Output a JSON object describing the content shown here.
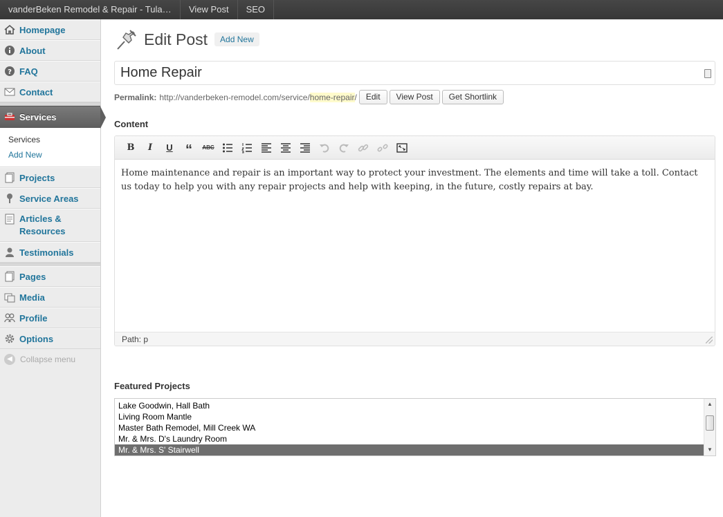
{
  "adminbar": {
    "site": "vanderBeken Remodel & Repair - Tulal...",
    "view_post": "View Post",
    "seo": "SEO"
  },
  "sidebar": {
    "items_top": [
      {
        "label": "Homepage",
        "icon": "house-icon"
      },
      {
        "label": "About",
        "icon": "info-icon"
      },
      {
        "label": "FAQ",
        "icon": "question-icon"
      },
      {
        "label": "Contact",
        "icon": "envelope-icon"
      }
    ],
    "current": {
      "label": "Services",
      "icon": "toolbox-icon"
    },
    "submenu": [
      "Services",
      "Add New"
    ],
    "items_mid": [
      {
        "label": "Projects",
        "icon": "pages-icon"
      },
      {
        "label": "Service Areas",
        "icon": "map-pin-icon"
      },
      {
        "label": "Articles & Resources",
        "icon": "document-icon"
      },
      {
        "label": "Testimonials",
        "icon": "user-icon"
      }
    ],
    "items_bottom": [
      {
        "label": "Pages",
        "icon": "pages-icon"
      },
      {
        "label": "Media",
        "icon": "media-icon"
      },
      {
        "label": "Profile",
        "icon": "users-icon"
      },
      {
        "label": "Options",
        "icon": "gear-icon"
      }
    ],
    "collapse": "Collapse menu"
  },
  "main": {
    "title": "Edit Post",
    "add_new": "Add New",
    "post_title": "Home Repair",
    "permalink_label": "Permalink:",
    "permalink_base": "http://vanderbeken-remodel.com/service/",
    "permalink_slug": "home-repair",
    "permalink_end": "/",
    "permalink_buttons": {
      "edit": "Edit",
      "view": "View Post",
      "shortlink": "Get Shortlink"
    },
    "content_label": "Content",
    "content_text": "Home maintenance and repair is an important way to protect your investment. The elements and time will take a toll. Contact us today to help you with any repair projects and help with keeping, in the future, costly repairs at bay.",
    "path": "Path: p",
    "featured_label": "Featured Projects",
    "featured_options": [
      "Lake Goodwin, Hall Bath",
      "Living Room Mantle",
      "Master Bath Remodel, Mill Creek WA",
      "Mr. & Mrs. D's Laundry Room",
      "Mr. & Mrs. S' Stairwell"
    ],
    "featured_selected": "Mr. & Mrs. S' Stairwell"
  },
  "toolbar": {
    "bold": "B",
    "italic": "I",
    "underline": "U",
    "quote": "“",
    "strike": "ABC"
  }
}
